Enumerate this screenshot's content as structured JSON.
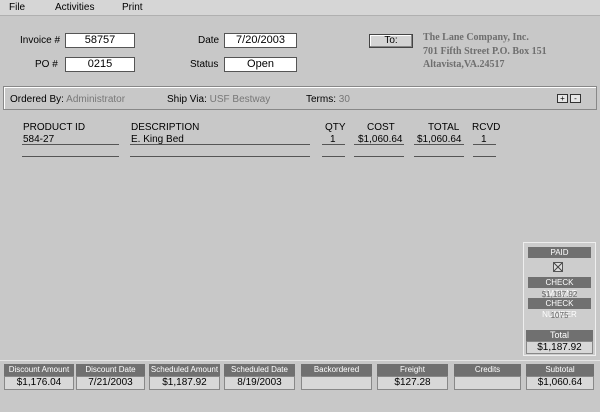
{
  "menu": [
    "File",
    "Activities",
    "Print"
  ],
  "invoice": {
    "invoice_label": "Invoice #",
    "invoice_value": "58757",
    "po_label": "PO #",
    "po_value": "0215",
    "date_label": "Date",
    "date_value": "7/20/2003",
    "status_label": "Status",
    "status_value": "Open",
    "to_button": "To:"
  },
  "address": {
    "line1": "The Lane Company, Inc.",
    "line2": "701 Fifth Street P.O. Box 151",
    "line3": "Altavista,VA.24517"
  },
  "order_info": {
    "ordered_by_label": "Ordered By:",
    "ordered_by_value": "Administrator",
    "ship_via_label": "Ship Via:",
    "ship_via_value": "USF Bestway",
    "terms_label": "Terms:",
    "terms_value": "30",
    "plus": "+",
    "minus": "-"
  },
  "table": {
    "headers": {
      "product_id": "PRODUCT ID",
      "description": "DESCRIPTION",
      "qty": "QTY",
      "cost": "COST",
      "total": "TOTAL",
      "rcvd": "RCVD"
    },
    "row": {
      "product_id": "584-27",
      "description": "E. King Bed",
      "qty": "1",
      "cost": "$1,060.64",
      "total": "$1,060.64",
      "rcvd": "1"
    }
  },
  "paid": {
    "title": "PAID",
    "check_amount_label": "CHECK AMOUNT",
    "check_amount_value": "$1,187.92",
    "check_number_label": "CHECK NUMBER",
    "check_number_value": "1075",
    "total_label": "Total",
    "total_value": "$1,187.92"
  },
  "summary": [
    {
      "label": "Discount Amount",
      "value": "$1,176.04"
    },
    {
      "label": "Discount Date",
      "value": "7/21/2003"
    },
    {
      "label": "Scheduled Amount",
      "value": "$1,187.92"
    },
    {
      "label": "Scheduled Date",
      "value": "8/19/2003"
    },
    {
      "label": "Backordered",
      "value": ""
    },
    {
      "label": "Freight",
      "value": "$127.28"
    },
    {
      "label": "Credits",
      "value": ""
    },
    {
      "label": "Subtotal",
      "value": "$1,060.64"
    }
  ]
}
